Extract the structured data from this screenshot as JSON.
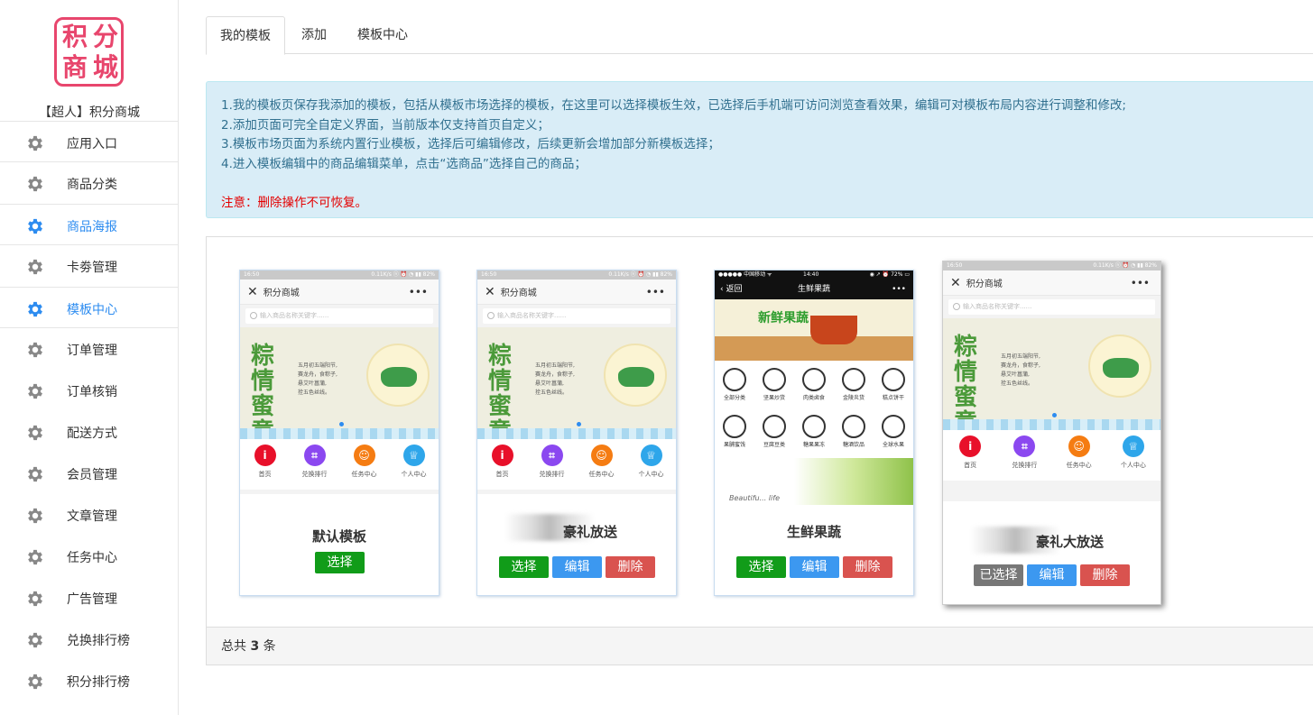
{
  "sidebar": {
    "logo": [
      "积",
      "分",
      "商",
      "城"
    ],
    "shop_name": "【超人】积分商城",
    "items": [
      {
        "label": "应用入口",
        "active": false
      },
      {
        "label": "商品分类",
        "active": false
      },
      {
        "label": "商品海报",
        "active": true
      },
      {
        "label": "卡劵管理",
        "active": false
      },
      {
        "label": "模板中心",
        "active": true
      },
      {
        "label": "订单管理",
        "active": false
      },
      {
        "label": "订单核销",
        "active": false
      },
      {
        "label": "配送方式",
        "active": false
      },
      {
        "label": "会员管理",
        "active": false
      },
      {
        "label": "文章管理",
        "active": false
      },
      {
        "label": "任务中心",
        "active": false
      },
      {
        "label": "广告管理",
        "active": false
      },
      {
        "label": "兑换排行榜",
        "active": false
      },
      {
        "label": "积分排行榜",
        "active": false
      }
    ]
  },
  "tabs": [
    "我的模板",
    "添加",
    "模板中心"
  ],
  "notice": {
    "lines": [
      "1.我的模板页保存我添加的模板，包括从模板市场选择的模板，在这里可以选择模板生效，已选择后手机端可访问浏览查看效果，编辑可对模板布局内容进行调整和修改;",
      "2.添加页面可完全自定义界面，当前版本仅支持首页自定义；",
      "3.模板市场页面为系统内置行业模板，选择后可编辑修改，后续更新会增加部分新模板选择；",
      "4.进入模板编辑中的商品编辑菜单，点击“选商品”选择自己的商品；"
    ],
    "warning": "注意：删除操作不可恢复。"
  },
  "phone": {
    "status_left": "16:50",
    "status_right": "0.11K/s ⓝ ⏰ ◔ ▮▮ 82%",
    "title": "积分商城",
    "search_placeholder": "输入商品名称关键字......",
    "banner_title": "粽情蜜意",
    "banner_poem": "五月初五端阳节,\n赛龙舟，食粽子,\n悬艾叶菖蒲,\n拴五色丝线。",
    "nav": [
      {
        "label": "首页",
        "icon": "info-icon",
        "color": "#e8102a"
      },
      {
        "label": "兑换排行",
        "icon": "scan-icon",
        "color": "#8b48f0"
      },
      {
        "label": "任务中心",
        "icon": "task-icon",
        "color": "#f57c12"
      },
      {
        "label": "个人中心",
        "icon": "crown-icon",
        "color": "#2ea6ea"
      }
    ]
  },
  "fresh_phone": {
    "status_left": "●●●●● 中国移动 ᯤ",
    "status_center": "14:40",
    "status_right": "◉ ↗ ⏰ 72% ▭",
    "back": "返回",
    "title": "生鲜果蔬",
    "banner": "新鲜果蔬",
    "grid": [
      "全部分类",
      "坚果炒货",
      "肉类卤食",
      "金陵炎货",
      "糕点饼干",
      "果脯蜜饯",
      "豆腐豆类",
      "糖果果冻",
      "糖酒饮品",
      "全球水果"
    ],
    "bottom_text": "Beautifu... life"
  },
  "templates": [
    {
      "title": "默认模板",
      "buttons": [
        "选择"
      ]
    },
    {
      "title": "豪礼放送",
      "buttons": [
        "选择",
        "编辑",
        "删除"
      ]
    },
    {
      "title": "生鲜果蔬",
      "buttons": [
        "选择",
        "编辑",
        "删除"
      ]
    },
    {
      "title": "豪礼大放送",
      "buttons": [
        "已选择",
        "编辑",
        "删除"
      ]
    }
  ],
  "footer": {
    "prefix": "总共",
    "count": "3",
    "suffix": "条"
  }
}
